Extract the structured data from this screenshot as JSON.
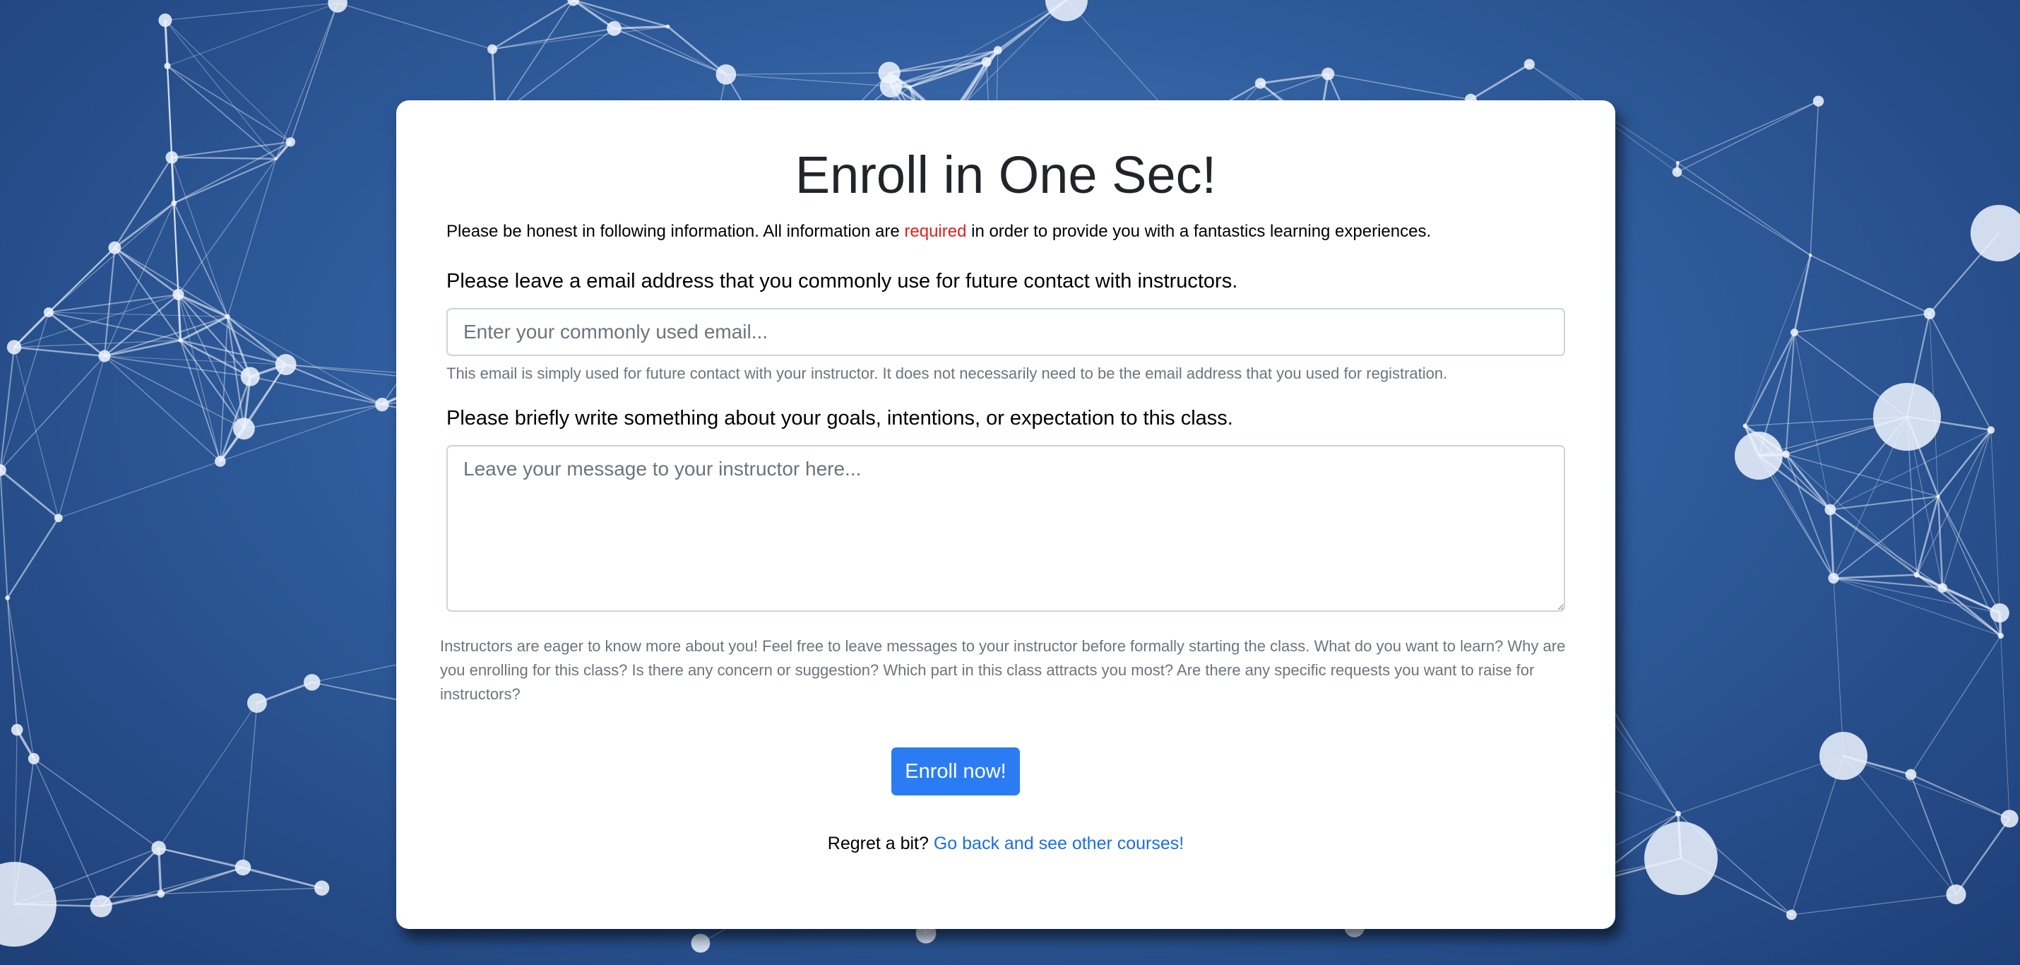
{
  "page": {
    "title": "Enroll in One Sec!",
    "intro_before": "Please be honest in following information. All information are ",
    "intro_required": "required",
    "intro_after": " in order to provide you with a fantastics learning experiences."
  },
  "email": {
    "label": "Please leave a email address that you commonly use for future contact with instructors.",
    "placeholder": "Enter your commonly used email...",
    "value": "",
    "help": "This email is simply used for future contact with your instructor. It does not necessarily need to be the email address that you used for registration."
  },
  "goals": {
    "label": "Please briefly write something about your goals, intentions, or expectation to this class.",
    "placeholder": "Leave your message to your instructor here...",
    "value": "",
    "note": "Instructors are eager to know more about you! Feel free to leave messages to your instructor before formally starting the class. What do you want to learn? Why are you enrolling for this class? Is there any concern or suggestion? Which part in this class attracts you most? Are there any specific requests you want to raise for instructors?"
  },
  "actions": {
    "enroll_label": "Enroll now!",
    "regret_text": "Regret a bit? ",
    "back_link": "Go back and see other courses!"
  },
  "colors": {
    "accent": "#2b7cf2",
    "link": "#1a6fe6",
    "required": "#e0201c",
    "background": "#2f5c9c"
  }
}
